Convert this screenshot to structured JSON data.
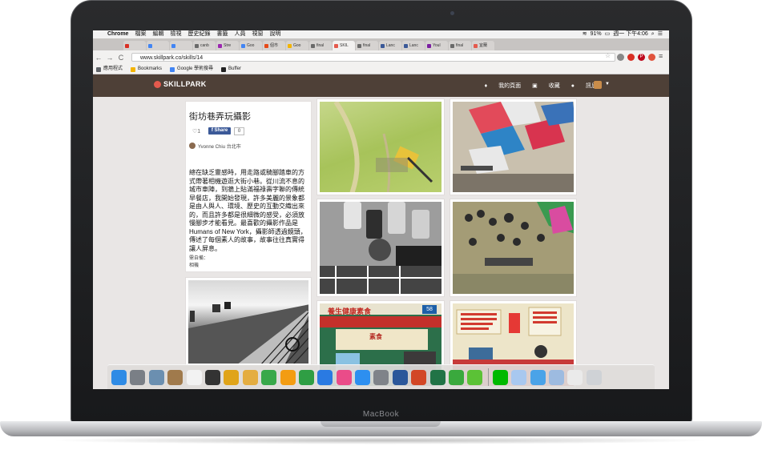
{
  "device": {
    "brand": "MacBook"
  },
  "menubar": {
    "app": "Chrome",
    "menus": [
      "檔案",
      "編輯",
      "檢視",
      "歷史紀錄",
      "書籤",
      "人員",
      "視窗",
      "說明"
    ],
    "battery": "91%",
    "clock": "週一 下午4:06"
  },
  "tabs": [
    {
      "label": "",
      "color": "#d93025"
    },
    {
      "label": "",
      "color": "#4285f4"
    },
    {
      "label": "",
      "color": "#4285f4"
    },
    {
      "label": "canb",
      "color": "#6a6a6a"
    },
    {
      "label": "Stre",
      "color": "#9c27b0"
    },
    {
      "label": "Goo",
      "color": "#4285f4"
    },
    {
      "label": "個市",
      "color": "#e64a19"
    },
    {
      "label": "Goo",
      "color": "#f4b400"
    },
    {
      "label": "final",
      "color": "#6a6a6a"
    },
    {
      "label": "SKIL",
      "color": "#e45a4d",
      "active": true
    },
    {
      "label": "final",
      "color": "#6a6a6a"
    },
    {
      "label": "Lanc",
      "color": "#3b5998"
    },
    {
      "label": "Lanc",
      "color": "#3b5998"
    },
    {
      "label": "Youl",
      "color": "#7b1fa2"
    },
    {
      "label": "final",
      "color": "#6a6a6a"
    },
    {
      "label": "宜蘭",
      "color": "#e45a4d"
    }
  ],
  "toolbar": {
    "back": "←",
    "forward": "→",
    "reload": "C",
    "url": "www.skillpark.co/skills/14"
  },
  "bookmarks": [
    {
      "label": "應用程式",
      "color": "#5f6368"
    },
    {
      "label": "Bookmarks",
      "color": "#f4b400"
    },
    {
      "label": "Google 學術搜尋",
      "color": "#4285f4"
    },
    {
      "label": "Buffer",
      "color": "#222222"
    }
  ],
  "site": {
    "logo": "SKILLPARK",
    "nav": [
      "我的頁面",
      "收藏",
      "訊息"
    ],
    "colors": {
      "header": "#4e4037",
      "logo": "#e45a4d"
    }
  },
  "skill": {
    "title": "街坊巷弄玩攝影",
    "like_label": "♡1",
    "share_label": "Share",
    "share_count": "0",
    "author": "Yvonne Chiu 台北市",
    "description": "總在缺乏靈感時，用走路或騎腳踏車的方式帶著相機遊逛大街小巷。從川流不息的城市車陣，到牆上貼滿福祿壽字聯的傳統早餐店，我開始發現，許多美麗的景象都是由人與人、環境、歷史的互動交織出來的，而且許多都是很細微的感受，必須放慢腳步才能看見。最喜歡的攝影作品是Humans of New York，攝影師透過鏡頭，傳述了每個素人的故事，故事往往真實得讓人屏息。",
    "tool_label": "需自備：",
    "tool_value": "相機",
    "storefront_sign": "養生健康素食",
    "storefront_number": "58",
    "storefront_menu": "素食"
  },
  "dock": [
    {
      "name": "finder",
      "color": "#2f8be5"
    },
    {
      "name": "launchpad",
      "color": "#7a7f86"
    },
    {
      "name": "preview",
      "color": "#6b8fb0"
    },
    {
      "name": "contacts",
      "color": "#a07a4c"
    },
    {
      "name": "calendar",
      "color": "#f2f2f2"
    },
    {
      "name": "photos-booth",
      "color": "#333333"
    },
    {
      "name": "chrome",
      "color": "#e0a419"
    },
    {
      "name": "photos",
      "color": "#e4ad41"
    },
    {
      "name": "facetime",
      "color": "#39a84a"
    },
    {
      "name": "pages",
      "color": "#f39c12"
    },
    {
      "name": "numbers",
      "color": "#2f9e44"
    },
    {
      "name": "keynote",
      "color": "#2a7ae2"
    },
    {
      "name": "itunes",
      "color": "#ea4c89"
    },
    {
      "name": "app-store",
      "color": "#2d8ff0"
    },
    {
      "name": "system-preferences",
      "color": "#7f8389"
    },
    {
      "name": "word",
      "color": "#2b579a"
    },
    {
      "name": "powerpoint",
      "color": "#d24726"
    },
    {
      "name": "excel",
      "color": "#217346"
    },
    {
      "name": "evernote",
      "color": "#3aa93d"
    },
    {
      "name": "messages",
      "color": "#5bc236"
    },
    {
      "name": "line",
      "color": "#00b900"
    },
    {
      "name": "documents-folder",
      "color": "#a8c8ef"
    },
    {
      "name": "applications-folder",
      "color": "#4aa3e8"
    },
    {
      "name": "downloads-folder",
      "color": "#9dbbe0"
    },
    {
      "name": "preview-doc",
      "color": "#eaeaea"
    },
    {
      "name": "trash",
      "color": "#cfd2d6"
    }
  ]
}
